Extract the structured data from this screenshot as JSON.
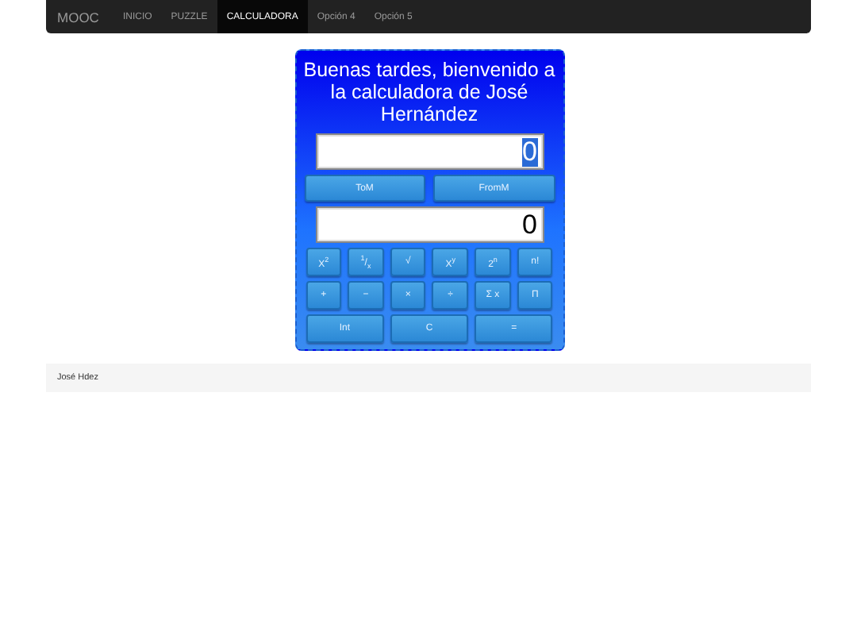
{
  "navbar": {
    "brand": "MOOC",
    "items": [
      {
        "label": "INICIO",
        "selected": false
      },
      {
        "label": "PUZZLE",
        "selected": false
      },
      {
        "label": "CALCULADORA",
        "selected": true
      },
      {
        "label": "Opción 4",
        "selected": false
      },
      {
        "label": "Opción 5",
        "selected": false
      }
    ]
  },
  "calculator": {
    "greeting": "Buenas tardes, bienvenido a la calculadora de José Hernández",
    "input": {
      "value": "0"
    },
    "memory_buttons": [
      "ToM",
      "FromM"
    ],
    "output": "0",
    "rows": [
      [
        "X$^{2}$",
        "$^{1}$/$_{x}$",
        "√",
        "X$^{y}$",
        "2$^{n}$",
        "n!"
      ],
      [
        "+",
        "−",
        "×",
        "÷",
        "Σ x",
        "Π"
      ],
      [
        "Int",
        "C",
        "="
      ]
    ]
  },
  "footer": "José Hdez"
}
